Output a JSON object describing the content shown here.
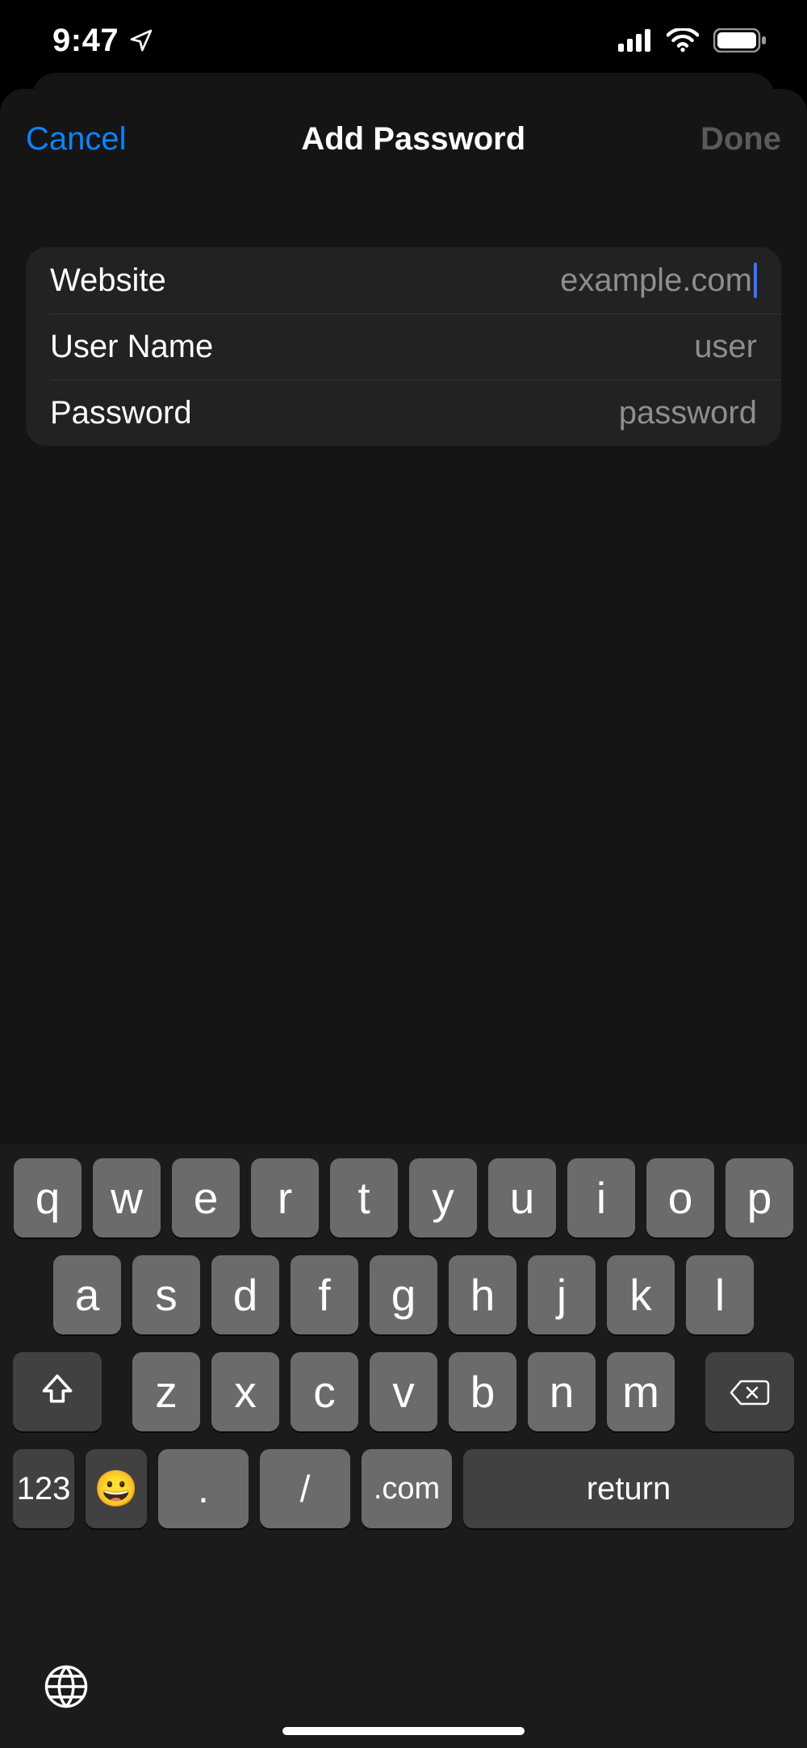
{
  "status": {
    "time": "9:47",
    "location_icon": "location-arrow-icon",
    "signal_icon": "cellular-signal-icon",
    "wifi_icon": "wifi-icon",
    "battery_icon": "battery-full-icon"
  },
  "navbar": {
    "cancel": "Cancel",
    "title": "Add Password",
    "done": "Done"
  },
  "form": {
    "website": {
      "label": "Website",
      "placeholder": "example.com",
      "value": ""
    },
    "username": {
      "label": "User Name",
      "placeholder": "user",
      "value": ""
    },
    "password": {
      "label": "Password",
      "placeholder": "password",
      "value": ""
    }
  },
  "keyboard": {
    "row1": [
      "q",
      "w",
      "e",
      "r",
      "t",
      "y",
      "u",
      "i",
      "o",
      "p"
    ],
    "row2": [
      "a",
      "s",
      "d",
      "f",
      "g",
      "h",
      "j",
      "k",
      "l"
    ],
    "row3": [
      "z",
      "x",
      "c",
      "v",
      "b",
      "n",
      "m"
    ],
    "numbers_label": "123",
    "dot_label": ".",
    "slash_label": "/",
    "dotcom_label": ".com",
    "return_label": "return",
    "emoji": "😀"
  }
}
